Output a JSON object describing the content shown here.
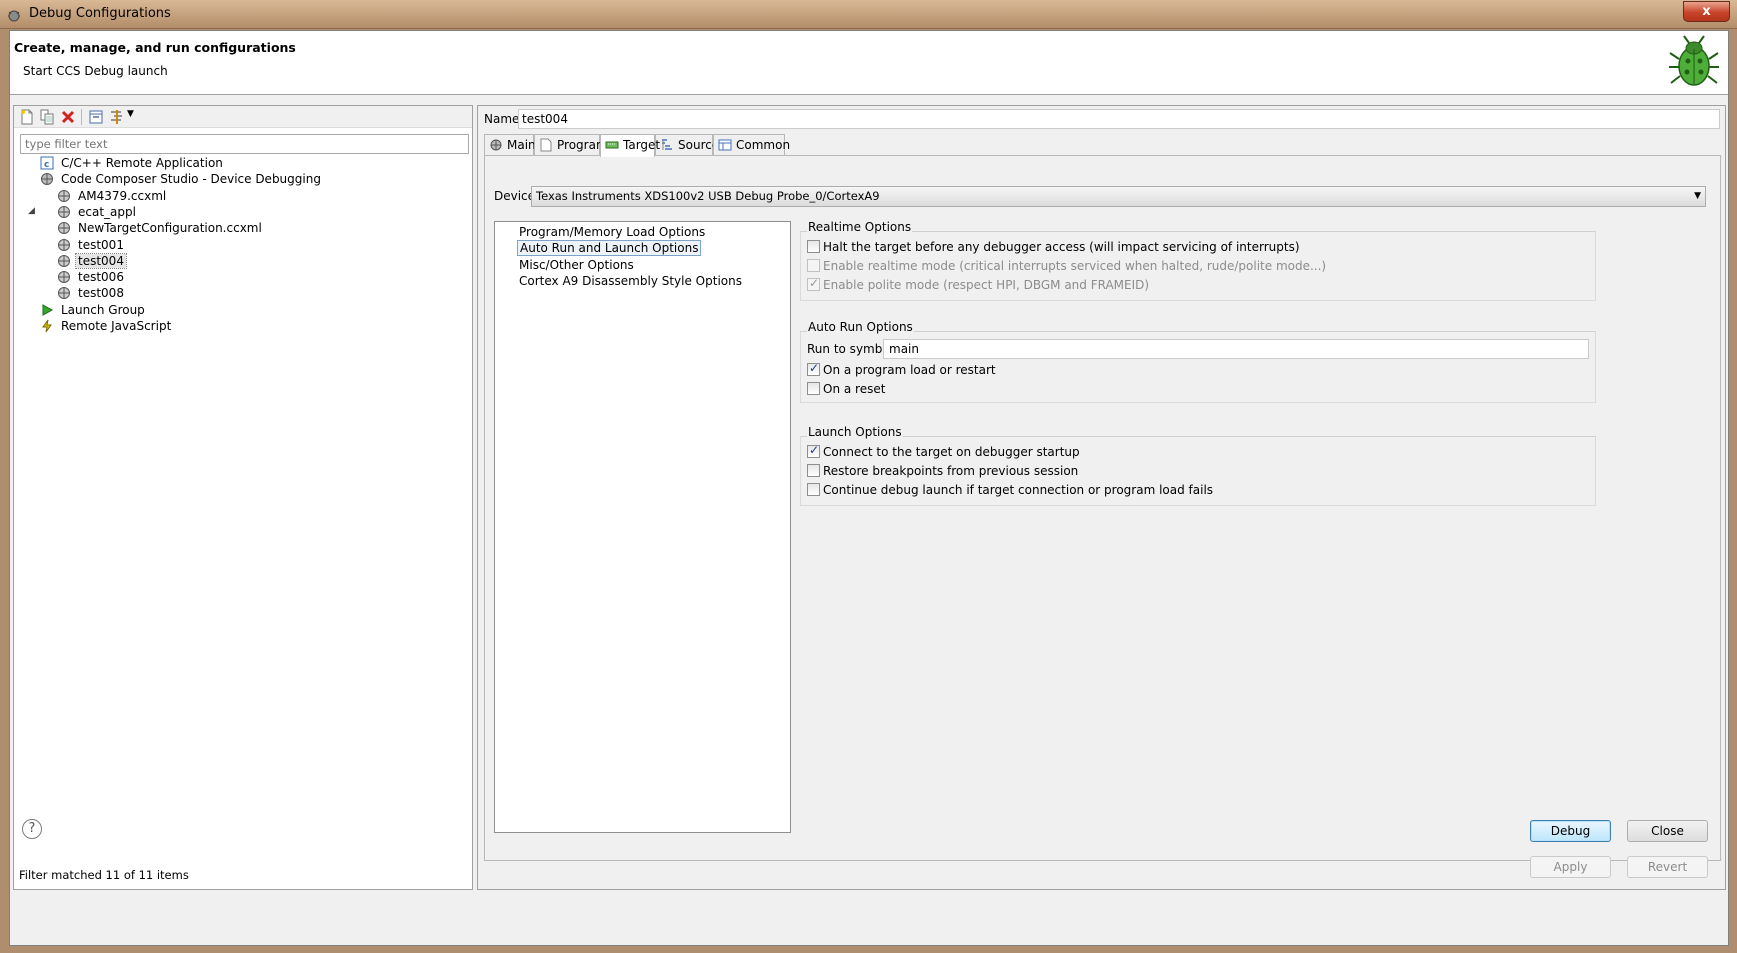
{
  "window": {
    "title": "Debug Configurations",
    "close_glyph": "x"
  },
  "header": {
    "title": "Create, manage, and run configurations",
    "subtitle": "Start CCS Debug launch",
    "icon": "bug-icon"
  },
  "left": {
    "toolbar": [
      "new-launch-configuration-icon",
      "duplicate-icon",
      "delete-icon",
      "collapse-all-icon",
      "filter-icon"
    ],
    "filter_placeholder": "type filter text",
    "tree": [
      {
        "label": "C/C++ Remote Application",
        "icon": "c-app-icon",
        "indent": 0
      },
      {
        "label": "Code Composer Studio - Device Debugging",
        "icon": "ccs-icon",
        "indent": 0,
        "expanded": true
      },
      {
        "label": "AM4379.ccxml",
        "icon": "ccs-config-icon",
        "indent": 1
      },
      {
        "label": "ecat_appl",
        "icon": "ccs-config-icon",
        "indent": 1
      },
      {
        "label": "NewTargetConfiguration.ccxml",
        "icon": "ccs-config-icon",
        "indent": 1
      },
      {
        "label": "test001",
        "icon": "ccs-config-icon",
        "indent": 1
      },
      {
        "label": "test004",
        "icon": "ccs-config-icon",
        "indent": 1,
        "selected": true
      },
      {
        "label": "test006",
        "icon": "ccs-config-icon",
        "indent": 1
      },
      {
        "label": "test008",
        "icon": "ccs-config-icon",
        "indent": 1
      },
      {
        "label": "Launch Group",
        "icon": "launch-group-icon",
        "indent": 0
      },
      {
        "label": "Remote JavaScript",
        "icon": "remote-javascript-icon",
        "indent": 0
      }
    ],
    "status": "Filter matched 11 of 11 items"
  },
  "right": {
    "name_label": "Name:",
    "name_value": "test004",
    "tabs": [
      {
        "label": "Main",
        "icon": "main-icon"
      },
      {
        "label": "Program",
        "icon": "program-icon"
      },
      {
        "label": "Target",
        "icon": "target-icon",
        "active": true
      },
      {
        "label": "Source",
        "icon": "source-icon"
      },
      {
        "label": "Common",
        "icon": "common-icon"
      }
    ],
    "device_label": "Device",
    "device_value": "Texas Instruments XDS100v2 USB Debug Probe_0/CortexA9",
    "options": [
      {
        "label": "Program/Memory Load Options"
      },
      {
        "label": "Auto Run and Launch Options",
        "selected": true
      },
      {
        "label": "Misc/Other Options"
      },
      {
        "label": "Cortex A9 Disassembly Style Options"
      }
    ],
    "realtime": {
      "title": "Realtime Options",
      "items": [
        {
          "label": "Halt the target before any debugger access (will impact servicing of interrupts)",
          "checked": false,
          "enabled": true
        },
        {
          "label": "Enable realtime mode (critical interrupts serviced when halted, rude/polite mode...)",
          "checked": false,
          "enabled": false
        },
        {
          "label": "Enable polite mode (respect HPI, DBGM and FRAMEID)",
          "checked": true,
          "enabled": false
        }
      ]
    },
    "autorun": {
      "title": "Auto Run Options",
      "run_to_label": "Run to symbol",
      "run_to_value": "main",
      "items": [
        {
          "label": "On a program load or restart",
          "checked": true
        },
        {
          "label": "On a reset",
          "checked": false
        }
      ]
    },
    "launch": {
      "title": "Launch Options",
      "items": [
        {
          "label": "Connect to the target on debugger startup",
          "checked": true
        },
        {
          "label": "Restore breakpoints from previous session",
          "checked": false
        },
        {
          "label": "Continue debug launch if target connection or program load fails",
          "checked": false
        }
      ]
    },
    "apply_label": "Apply",
    "revert_label": "Revert"
  },
  "footer": {
    "help_glyph": "?",
    "debug_label": "Debug",
    "close_label": "Close"
  }
}
